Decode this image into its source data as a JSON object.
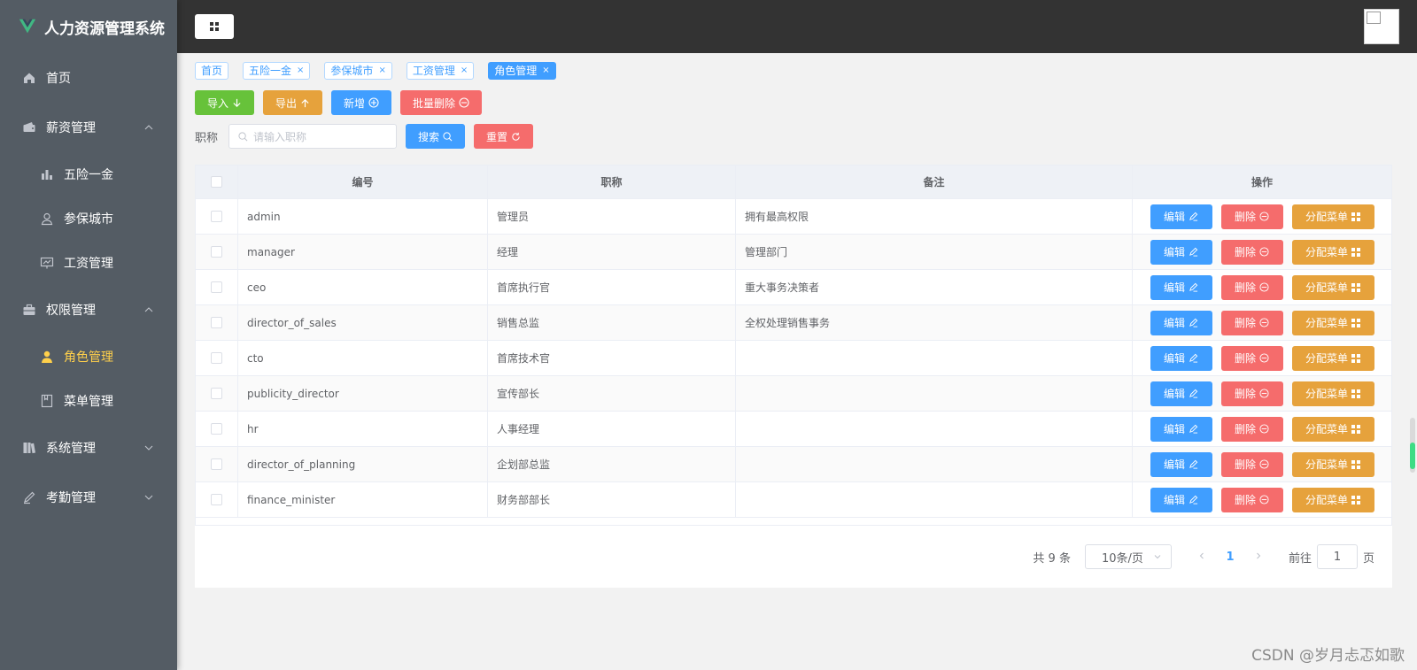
{
  "app": {
    "title": "人力资源管理系统"
  },
  "sidebar": {
    "items": [
      {
        "label": "首页",
        "icon": "home-icon",
        "level": 1
      },
      {
        "label": "薪资管理",
        "icon": "wallet-icon",
        "level": 1,
        "expanded": true
      },
      {
        "label": "五险一金",
        "icon": "bar-chart-icon",
        "level": 2
      },
      {
        "label": "参保城市",
        "icon": "user-outline-icon",
        "level": 2
      },
      {
        "label": "工资管理",
        "icon": "presentation-icon",
        "level": 2
      },
      {
        "label": "权限管理",
        "icon": "briefcase-icon",
        "level": 1,
        "expanded": true
      },
      {
        "label": "角色管理",
        "icon": "user-filled-icon",
        "level": 2,
        "active": true
      },
      {
        "label": "菜单管理",
        "icon": "notebook-icon",
        "level": 2
      },
      {
        "label": "系统管理",
        "icon": "books-icon",
        "level": 1,
        "expanded": false
      },
      {
        "label": "考勤管理",
        "icon": "edit-icon",
        "level": 1,
        "expanded": false
      }
    ]
  },
  "tags": [
    {
      "label": "首页",
      "closable": false
    },
    {
      "label": "五险一金",
      "closable": true
    },
    {
      "label": "参保城市",
      "closable": true
    },
    {
      "label": "工资管理",
      "closable": true
    },
    {
      "label": "角色管理",
      "closable": true,
      "active": true
    }
  ],
  "toolbar": {
    "import_label": "导入",
    "export_label": "导出",
    "add_label": "新增",
    "batch_delete_label": "批量删除"
  },
  "search": {
    "label": "职称",
    "placeholder": "请输入职称",
    "search_label": "搜索",
    "reset_label": "重置"
  },
  "table": {
    "headers": {
      "id": "编号",
      "name": "职称",
      "note": "备注",
      "ops": "操作"
    },
    "ops_labels": {
      "edit": "编辑",
      "delete": "删除",
      "assign": "分配菜单"
    },
    "rows": [
      {
        "id": "admin",
        "name": "管理员",
        "note": "拥有最高权限"
      },
      {
        "id": "manager",
        "name": "经理",
        "note": "管理部门"
      },
      {
        "id": "ceo",
        "name": "首席执行官",
        "note": "重大事务决策者"
      },
      {
        "id": "director_of_sales",
        "name": "销售总监",
        "note": "全权处理销售事务"
      },
      {
        "id": "cto",
        "name": "首席技术官",
        "note": ""
      },
      {
        "id": "publicity_director",
        "name": "宣传部长",
        "note": ""
      },
      {
        "id": "hr",
        "name": "人事经理",
        "note": ""
      },
      {
        "id": "director_of_planning",
        "name": "企划部总监",
        "note": ""
      },
      {
        "id": "finance_minister",
        "name": "财务部部长",
        "note": ""
      }
    ]
  },
  "pagination": {
    "total": "共 9 条",
    "page_size": "10条/页",
    "current": "1",
    "goto_prefix": "前往",
    "goto_value": "1",
    "goto_suffix": "页"
  },
  "watermark": "CSDN @岁月忐忑如歌",
  "colors": {
    "sidebar_bg": "#545c64",
    "header_bg": "#333333",
    "active_menu": "#ffd04b",
    "primary": "#409eff",
    "success": "#67c23a",
    "warning": "#e6a23c",
    "danger": "#f56c6c"
  }
}
